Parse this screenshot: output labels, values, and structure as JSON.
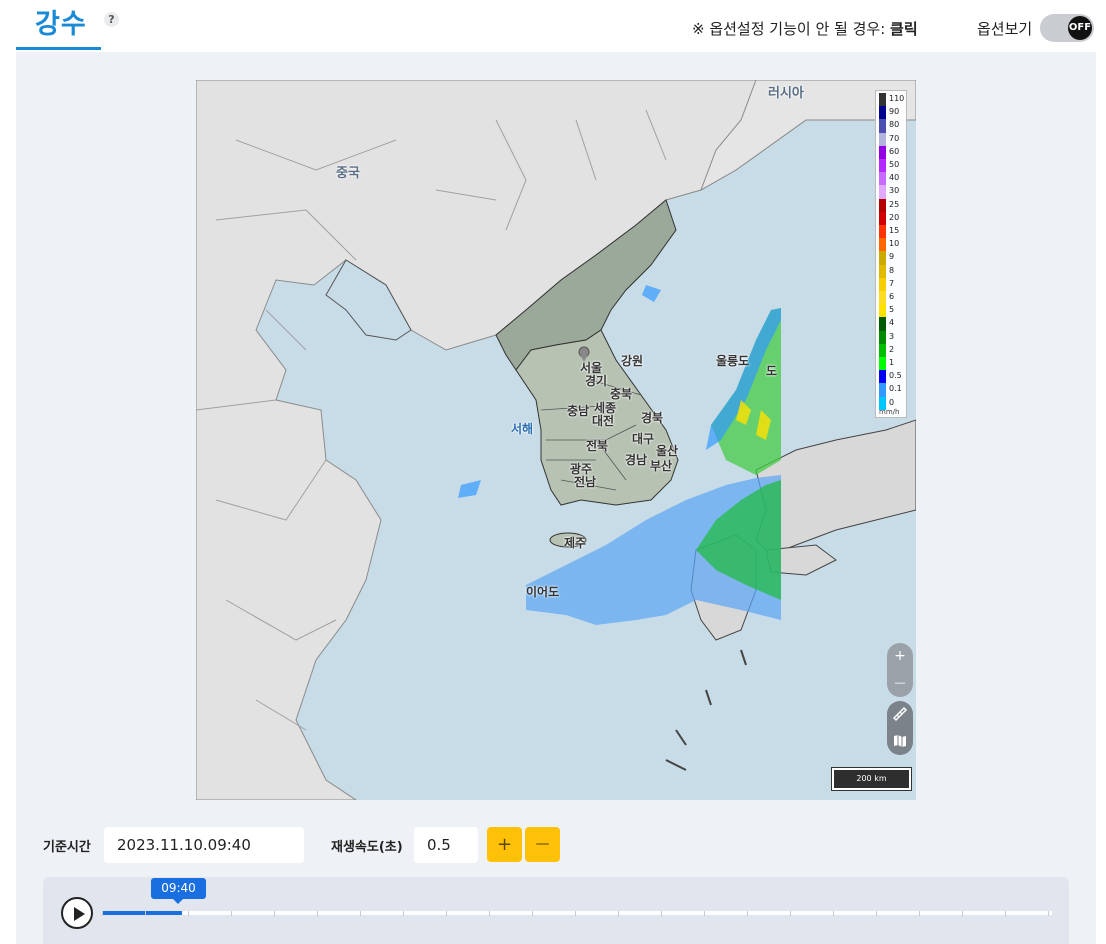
{
  "header": {
    "title": "강수",
    "help": "?",
    "notice_prefix": "※ 옵션설정 기능이 안 될 경우:",
    "notice_link": "클릭",
    "option_label": "옵션보기",
    "toggle_state": "OFF"
  },
  "map": {
    "labels": {
      "russia": "러시아",
      "china": "중국",
      "seoul": "서울",
      "gyeonggi": "경기",
      "gangwon": "강원",
      "chungbuk": "충북",
      "chungnam": "충남",
      "sejong": "세종",
      "daejeon": "대전",
      "gyeongbuk": "경북",
      "jeonbuk": "전북",
      "daegu": "대구",
      "ulsan": "울산",
      "gyeongnam": "경남",
      "busan": "부산",
      "gwangju": "광주",
      "jeonnam": "전남",
      "jeju": "제주",
      "ieodo": "이어도",
      "ulleungdo": "울릉도",
      "dokdo": "도",
      "west_sea": "서해"
    },
    "legend": {
      "unit": "mm/h",
      "items": [
        {
          "label": "110",
          "color": "#333333"
        },
        {
          "label": "90",
          "color": "#000390"
        },
        {
          "label": "80",
          "color": "#4c4eb1"
        },
        {
          "label": "70",
          "color": "#b3b4de"
        },
        {
          "label": "60",
          "color": "#9300e4"
        },
        {
          "label": "50",
          "color": "#b329ff"
        },
        {
          "label": "40",
          "color": "#c969ff"
        },
        {
          "label": "30",
          "color": "#e0a9ff"
        },
        {
          "label": "25",
          "color": "#b40000"
        },
        {
          "label": "20",
          "color": "#d20000"
        },
        {
          "label": "15",
          "color": "#ff3300"
        },
        {
          "label": "10",
          "color": "#ff6600"
        },
        {
          "label": "9",
          "color": "#ccaa00"
        },
        {
          "label": "8",
          "color": "#e0b900"
        },
        {
          "label": "7",
          "color": "#f9cd00"
        },
        {
          "label": "6",
          "color": "#ffdc1f"
        },
        {
          "label": "5",
          "color": "#ffe100"
        },
        {
          "label": "4",
          "color": "#005a00"
        },
        {
          "label": "3",
          "color": "#008c00"
        },
        {
          "label": "2",
          "color": "#00be00"
        },
        {
          "label": "1",
          "color": "#00ff00"
        },
        {
          "label": "0.5",
          "color": "#0000f6"
        },
        {
          "label": "0.1",
          "color": "#3399ff"
        },
        {
          "label": "0",
          "color": "#00c8ff"
        }
      ]
    },
    "zoom_in": "+",
    "zoom_out": "—",
    "scale": "200 km"
  },
  "controls": {
    "base_time_label": "기준시간",
    "base_time_value": "2023.11.10.09:40",
    "speed_label": "재생속도(초)",
    "speed_value": "0.5",
    "plus": "+",
    "minus": "—"
  },
  "timeline": {
    "current_time": "09:40",
    "progress": 0.084
  }
}
